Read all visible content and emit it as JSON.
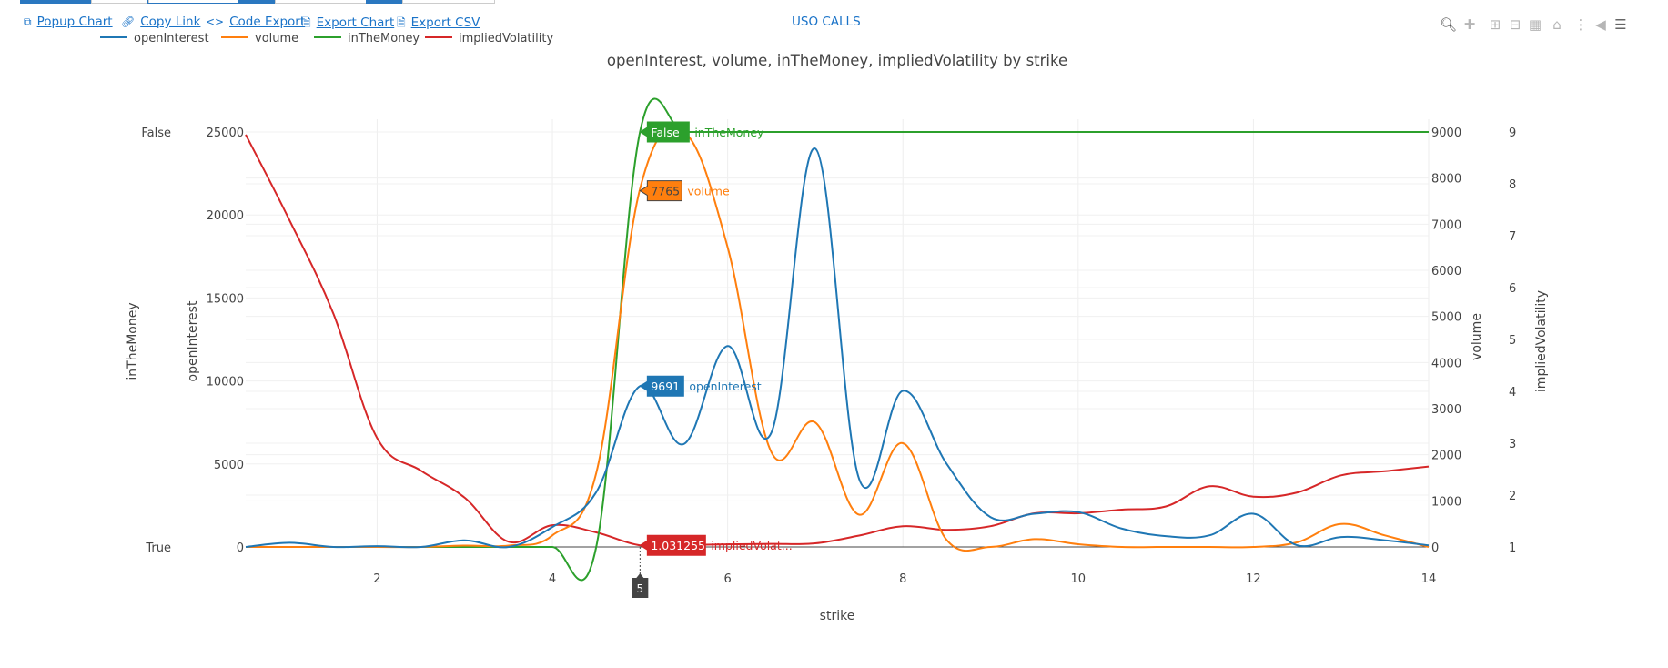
{
  "toolbar": {
    "links": [
      {
        "label": "Popup Chart",
        "icon": "popup-icon"
      },
      {
        "label": "Copy Link",
        "icon": "link-icon"
      },
      {
        "label": "Code Export",
        "icon": "code-icon"
      },
      {
        "label": "Export Chart",
        "icon": "file-icon"
      },
      {
        "label": "Export CSV",
        "icon": "file-icon"
      }
    ],
    "chart_name": "USO CALLS",
    "modebar": [
      "zoom-icon",
      "pan-icon",
      "zoom-in-icon",
      "zoom-out-icon",
      "autoscale-icon",
      "reset-axes-icon",
      "spike-lines-icon",
      "hover-closest-icon",
      "hover-compare-icon"
    ]
  },
  "colors": {
    "openInterest": "#1f77b4",
    "volume": "#ff7f0e",
    "inTheMoney": "#2ca02c",
    "impliedVolatility": "#d62728",
    "link": "#1a73c8"
  },
  "hover": {
    "x_label": "5",
    "labels": [
      {
        "series": "inTheMoney",
        "value": "False",
        "name": "inTheMoney"
      },
      {
        "series": "volume",
        "value": "7765",
        "name": "volume"
      },
      {
        "series": "openInterest",
        "value": "9691",
        "name": "openInterest"
      },
      {
        "series": "impliedVolatility",
        "value": "1.031255",
        "name": "impliedVolat..."
      }
    ]
  },
  "chart_data": {
    "type": "line",
    "title": "openInterest, volume, inTheMoney, impliedVolatility by strike",
    "xlabel": "strike",
    "xlim": [
      0.5,
      14
    ],
    "x_ticks": [
      2,
      4,
      6,
      8,
      10,
      12,
      14
    ],
    "legend_position": "top-left",
    "grid": true,
    "axes": {
      "openInterest": {
        "label": "openInterest",
        "range": [
          0,
          25000
        ],
        "ticks": [
          0,
          5000,
          10000,
          15000,
          20000,
          25000
        ],
        "side": "left"
      },
      "inTheMoney": {
        "label": "inTheMoney",
        "categories": [
          "True",
          "False"
        ],
        "side": "left"
      },
      "volume": {
        "label": "volume",
        "range": [
          0,
          9000
        ],
        "ticks": [
          0,
          1000,
          2000,
          3000,
          4000,
          5000,
          6000,
          7000,
          8000,
          9000
        ],
        "side": "right"
      },
      "impliedVolatility": {
        "label": "impliedVolatility",
        "range": [
          1,
          9
        ],
        "ticks": [
          1,
          2,
          3,
          4,
          5,
          6,
          7,
          8,
          9
        ],
        "side": "right"
      }
    },
    "x": [
      0.5,
      1,
      1.5,
      2,
      2.5,
      3,
      3.5,
      4,
      4.5,
      5,
      5.5,
      6,
      6.5,
      7,
      7.5,
      8,
      8.5,
      9,
      9.5,
      10,
      10.5,
      11,
      11.5,
      12,
      12.5,
      13,
      13.5,
      14
    ],
    "series": [
      {
        "name": "openInterest",
        "axis": "openInterest",
        "values": [
          0,
          250,
          0,
          50,
          0,
          400,
          0,
          1200,
          3300,
          9691,
          6200,
          12100,
          6900,
          24000,
          4100,
          9400,
          5000,
          1800,
          2000,
          2100,
          1100,
          650,
          700,
          2000,
          100,
          600,
          400,
          100
        ]
      },
      {
        "name": "volume",
        "axis": "volume",
        "values": [
          0,
          0,
          0,
          0,
          0,
          30,
          30,
          250,
          1600,
          7765,
          9000,
          6500,
          2050,
          2700,
          700,
          2250,
          150,
          0,
          170,
          60,
          0,
          0,
          0,
          0,
          100,
          500,
          250,
          0
        ]
      },
      {
        "name": "inTheMoney",
        "axis": "inTheMoney",
        "values": [
          "True",
          "True",
          "True",
          "True",
          "True",
          "True",
          "True",
          "True",
          "True",
          "False",
          "False",
          "False",
          "False",
          "False",
          "False",
          "False",
          "False",
          "False",
          "False",
          "False",
          "False",
          "False",
          "False",
          "False",
          "False",
          "False",
          "False",
          "False"
        ]
      },
      {
        "name": "impliedVolatility",
        "axis": "impliedVolatility",
        "values": [
          8.95,
          7.3,
          5.5,
          3.1,
          2.47,
          1.95,
          1.1,
          1.42,
          1.28,
          1.031255,
          1.04,
          1.05,
          1.06,
          1.07,
          1.22,
          1.4,
          1.33,
          1.4,
          1.65,
          1.65,
          1.72,
          1.78,
          2.17,
          1.97,
          2.05,
          2.38,
          2.46,
          2.55
        ]
      }
    ]
  }
}
